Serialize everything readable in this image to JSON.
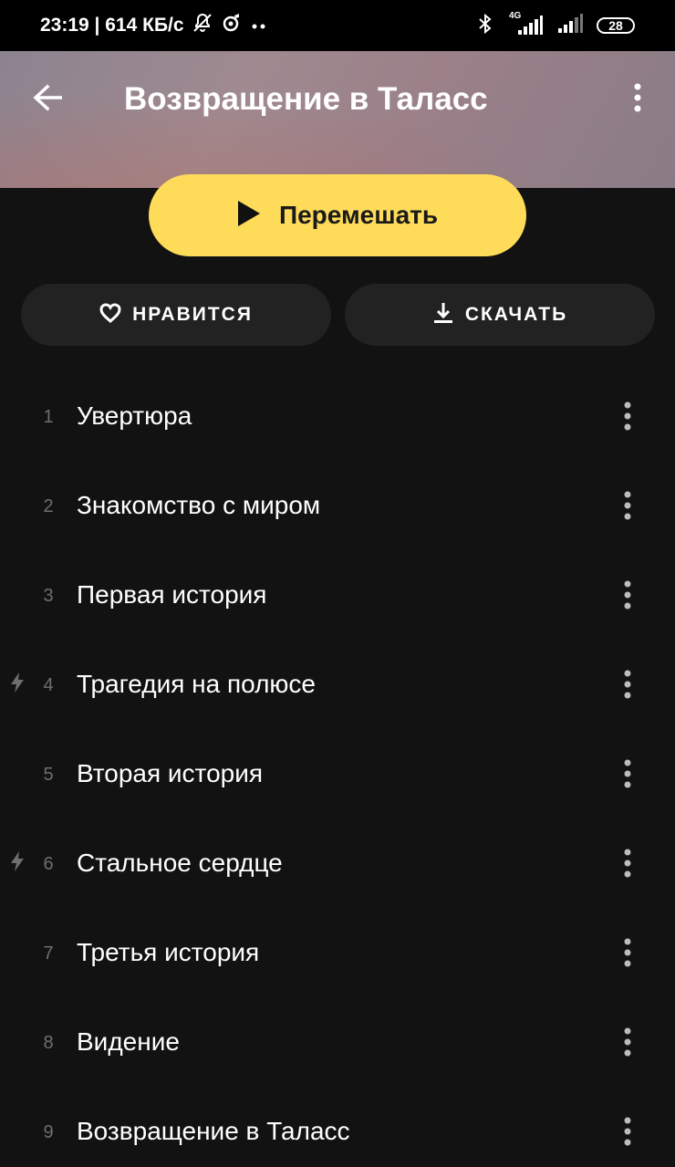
{
  "status_bar": {
    "time_speed": "23:19 | 614 КБ/с",
    "network_label": "4G",
    "battery": "28",
    "icons": [
      "bell-off-icon",
      "music-app-icon",
      "dots-icon",
      "bluetooth-icon",
      "signal-4g-icon",
      "signal-icon"
    ]
  },
  "header": {
    "title": "Возвращение в Таласс",
    "back_icon": "arrow-left-icon",
    "menu_icon": "more-vertical-icon"
  },
  "shuffle": {
    "label": "Перемешать",
    "icon": "play-icon",
    "color": "#fedc5a"
  },
  "actions": {
    "like": {
      "label": "НРАВИТСЯ",
      "icon": "heart-icon"
    },
    "download": {
      "label": "СКАЧАТЬ",
      "icon": "download-icon"
    }
  },
  "tracks": [
    {
      "number": "1",
      "title": "Увертюра",
      "bolt": false
    },
    {
      "number": "2",
      "title": "Знакомство с миром",
      "bolt": false
    },
    {
      "number": "3",
      "title": "Первая история",
      "bolt": false
    },
    {
      "number": "4",
      "title": "Трагедия на полюсе",
      "bolt": true
    },
    {
      "number": "5",
      "title": "Вторая история",
      "bolt": false
    },
    {
      "number": "6",
      "title": "Стальное сердце",
      "bolt": true
    },
    {
      "number": "7",
      "title": "Третья история",
      "bolt": false
    },
    {
      "number": "8",
      "title": "Видение",
      "bolt": false
    },
    {
      "number": "9",
      "title": "Возвращение в Таласс",
      "bolt": false
    }
  ],
  "colors": {
    "background": "#121212",
    "accent": "#fedc5a",
    "button_bg": "#222222",
    "track_number": "#6f6f6f"
  }
}
